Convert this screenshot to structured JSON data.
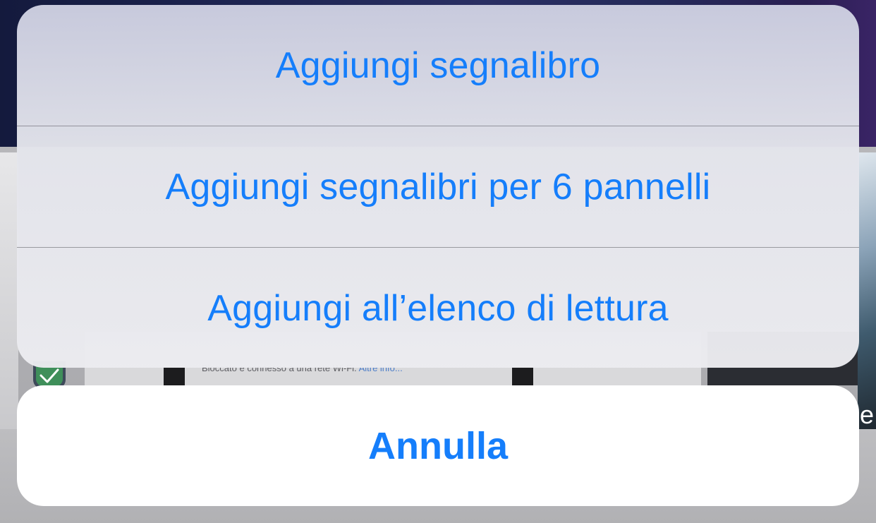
{
  "background": {
    "card_text": "Bloccato e connesso a una rete Wi-Fi.",
    "card_link": "Altre info...",
    "right_letter": "e",
    "shield_icon": "shield-check-icon"
  },
  "action_sheet": {
    "items": [
      {
        "label": "Aggiungi segnalibro"
      },
      {
        "label": "Aggiungi segnalibri per 6 pannelli"
      },
      {
        "label": "Aggiungi all’elenco di lettura"
      }
    ],
    "cancel_label": "Annulla"
  },
  "colors": {
    "accent": "#157efb",
    "sheet_background": "#ececf0",
    "cancel_background": "#ffffff"
  }
}
